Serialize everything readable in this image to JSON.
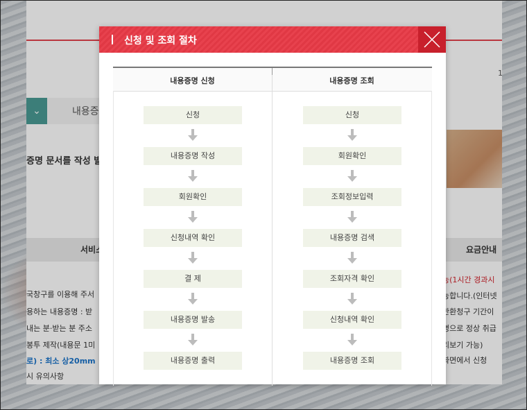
{
  "background": {
    "select_label": "내용증",
    "doc_title": "증명 문서를 작성 발",
    "service_header": "서비스",
    "fee_header": "요금안내",
    "page_number": "1",
    "lines_left": [
      "국창구를 이용해 주서",
      "용하는 내용증명 : 받",
      "내는 분·받는 분 주소",
      "봉투 제작(내용문 1미",
      "로) : 최소 상20mm",
      "시 유의사항"
    ],
    "lines_right": [
      "능(1시간 경과시",
      "능합니다.(인터넷",
      "반환청구 기간이",
      "명으로 정상 취급",
      "리보기 가능)",
      "화면에서 신청"
    ]
  },
  "modal": {
    "title": "신청 및 조회 절차",
    "close_icon": "close-icon",
    "columns": [
      {
        "header": "내용증명 신청",
        "steps": [
          "신청",
          "내용증명 작성",
          "회원확인",
          "신청내역 확인",
          "결 제",
          "내용증명 발송",
          "내용증명 출력"
        ]
      },
      {
        "header": "내용증명 조회",
        "steps": [
          "신청",
          "회원확인",
          "조회정보입력",
          "내용증명 검색",
          "조회자격 확인",
          "신청내역 확인",
          "내용증명 조회"
        ]
      }
    ]
  },
  "colors": {
    "accent": "#e8424e",
    "close_bg": "#c8202c",
    "step_bg": "#f0f3e8",
    "teal": "#4a9a94"
  }
}
